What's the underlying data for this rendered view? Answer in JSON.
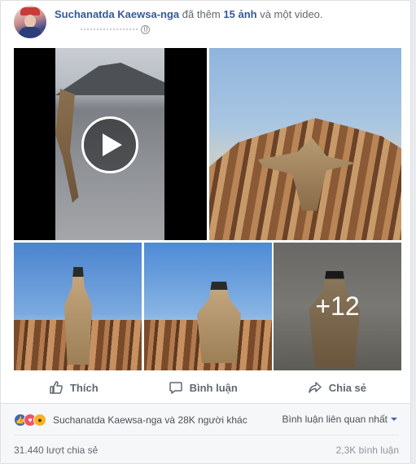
{
  "post": {
    "author": "Suchanatda Kaewsa-nga",
    "action_prefix": "đã thêm",
    "action_count": "15 ảnh",
    "action_suffix": "và một video."
  },
  "media": {
    "more_count": "+12"
  },
  "actions": {
    "like": "Thích",
    "comment": "Bình luận",
    "share": "Chia sẻ"
  },
  "reactions": {
    "summary": "Suchanatda Kaewsa-nga và 28K người khác",
    "types": [
      "like",
      "love",
      "wow"
    ]
  },
  "comments": {
    "sort_label": "Bình luận liên quan nhất",
    "count": "2,3K bình luận"
  },
  "shares": {
    "count": "31.440 lượt chia sẻ"
  },
  "colors": {
    "link": "#365899",
    "like_blue": "#4267b2",
    "love_red": "#f25268",
    "wow_yellow": "#f7b125"
  }
}
